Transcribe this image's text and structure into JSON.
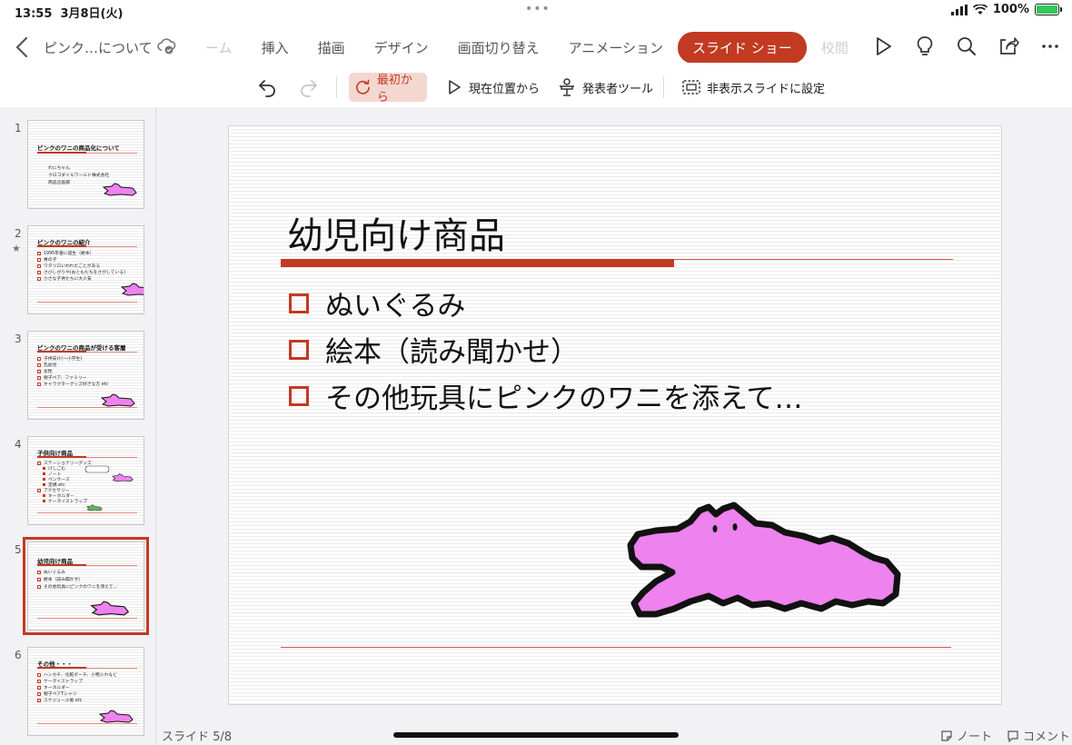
{
  "status_bar": {
    "time": "13:55",
    "date": "3月8日(火)",
    "battery": "100%"
  },
  "header": {
    "doc_title": "ピンク…について",
    "tabs": [
      {
        "label": "ーム"
      },
      {
        "label": "挿入"
      },
      {
        "label": "描画"
      },
      {
        "label": "デザイン"
      },
      {
        "label": "画面切り替え"
      },
      {
        "label": "アニメーション"
      },
      {
        "label": "スライド ショー"
      },
      {
        "label": "校閲"
      }
    ],
    "active_tab": "スライド ショー"
  },
  "ribbon": {
    "from_beginning": "最初から",
    "from_current": "現在位置から",
    "presenter_tools": "発表者ツール",
    "hide_slide": "非表示スライドに設定"
  },
  "thumbnails": [
    {
      "num": "1",
      "title": "ピンクのワニの商品化について",
      "lines": [
        "わにちゃん",
        "クロコダイルワールド株式会社",
        "商品企画部"
      ]
    },
    {
      "num": "2",
      "star": "★",
      "title": "ピンクのワニの紹介",
      "items": [
        "1995年春に誕生（絵本）",
        "男の子",
        "ワタツロいわれたことがある",
        "さびしがりや(おともだちをさがしている)",
        "小さな子供たちに大人気"
      ]
    },
    {
      "num": "3",
      "title": "ピンクのワニの商品が受ける客層",
      "items": [
        "子供向け(～小学生)",
        "乳幼児",
        "女性",
        "親子ペア、ファミリー",
        "キャラクターグッズ好きな方 etc"
      ]
    },
    {
      "num": "4",
      "title": "子供向け商品",
      "items": [
        "ステーショナリーグッズ",
        "けしごむ",
        "ノート",
        "ペンケース",
        "定規 etc",
        "アクセサリー",
        "キーホルダー",
        "ケータイストラップ"
      ]
    },
    {
      "num": "5",
      "title": "幼児向け商品",
      "items": [
        "ぬいぐるみ",
        "絵本（読み聞かせ）",
        "その他玩具にピンクのワニを添えて…"
      ]
    },
    {
      "num": "6",
      "title": "その他・・・",
      "items": [
        "ハンカチ、化粧ポーチ、小物入れなど",
        "ケータイストラップ",
        "キーホルダー",
        "親子ペアTシャツ",
        "スケジュール帳 etc"
      ]
    }
  ],
  "slide": {
    "title": "幼児向け商品",
    "items": [
      "ぬいぐるみ",
      "絵本（読み聞かせ）",
      "その他玩具にピンクのワニを添えて…"
    ]
  },
  "footer": {
    "slide_counter": "スライド 5/8",
    "notes": "ノート",
    "comments": "コメント"
  },
  "colors": {
    "accent": "#c23a22",
    "croc_pink": "#ee82ee"
  },
  "icons": [
    "back-chevron-icon",
    "cloud-check-icon",
    "play-icon",
    "lightbulb-icon",
    "search-icon",
    "share-icon",
    "more-icon",
    "undo-icon",
    "redo-icon",
    "restart-icon",
    "play-outline-icon",
    "presenter-icon",
    "hidden-slide-icon",
    "note-icon",
    "comment-icon"
  ]
}
